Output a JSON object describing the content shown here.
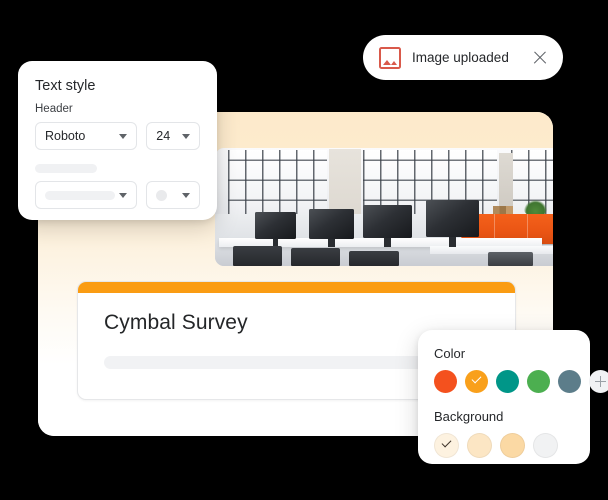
{
  "toast": {
    "icon": "image-icon",
    "message": "Image uploaded",
    "close_icon": "close-icon",
    "icon_color": "#d9594a"
  },
  "text_style_panel": {
    "title": "Text style",
    "header_label": "Header",
    "font_value": "Roboto",
    "size_value": "24",
    "font_caret_icon": "chevron-down-icon",
    "size_caret_icon": "chevron-down-icon",
    "secondary_caret_icon": "chevron-down-icon",
    "secondary_swatch_caret_icon": "chevron-down-icon"
  },
  "editor": {
    "hero_image_alt": "office-workspace-photo",
    "survey": {
      "accent_color": "#fa9c13",
      "title": "Cymbal Survey"
    },
    "canvas_background": "#fdeacb"
  },
  "color_panel": {
    "color_label": "Color",
    "background_label": "Background",
    "add_color_icon": "plus-icon",
    "colors": [
      {
        "name": "color-swatch-orange-red",
        "hex": "#f4511e",
        "selected": false
      },
      {
        "name": "color-swatch-amber",
        "hex": "#f9a01b",
        "selected": true
      },
      {
        "name": "color-swatch-teal",
        "hex": "#009688",
        "selected": false
      },
      {
        "name": "color-swatch-green",
        "hex": "#4caf50",
        "selected": false
      },
      {
        "name": "color-swatch-blue-grey",
        "hex": "#5c7d8a",
        "selected": false
      }
    ],
    "backgrounds": [
      {
        "name": "background-swatch-cream",
        "hex": "#fdf2e0",
        "selected": true
      },
      {
        "name": "background-swatch-light-peach",
        "hex": "#fce6c4",
        "selected": false
      },
      {
        "name": "background-swatch-peach",
        "hex": "#fbd9a4",
        "selected": false
      },
      {
        "name": "background-swatch-grey",
        "hex": "#f1f2f3",
        "selected": false
      }
    ]
  }
}
